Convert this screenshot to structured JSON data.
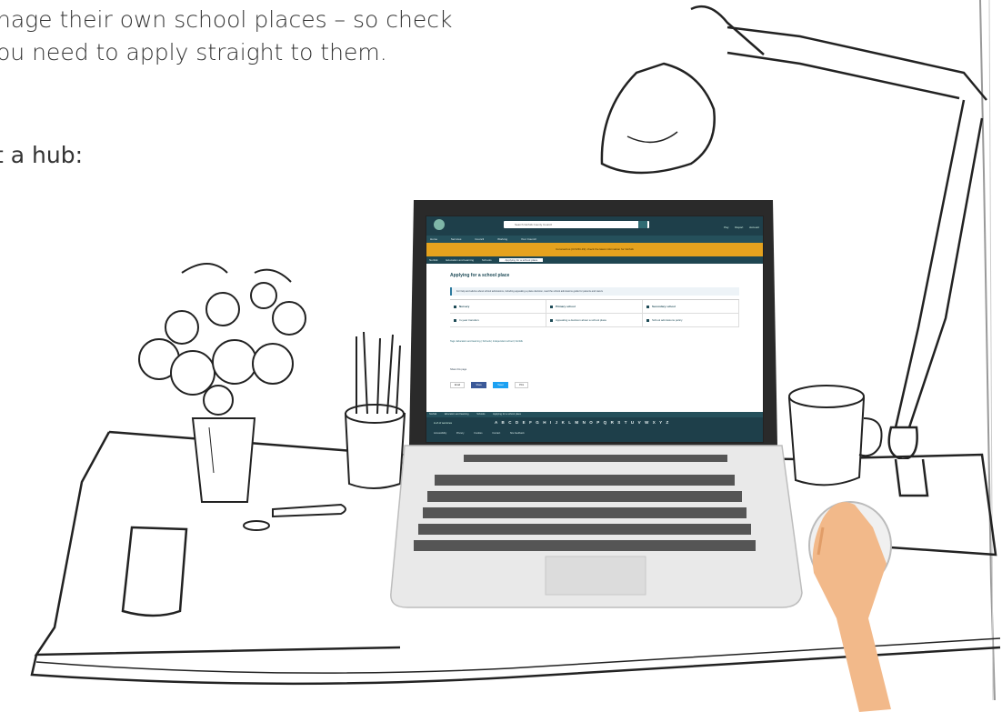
{
  "intro_text": {
    "line1": "nage their own school places – so check",
    "line2": "ou need to apply straight to them."
  },
  "hub_text": "t a hub:",
  "screen": {
    "search_placeholder": "Search Norfolk County Council",
    "utility_links": [
      "Pay",
      "Report",
      "Account"
    ],
    "nav_items": [
      "Home",
      "Services",
      "Council",
      "Working",
      "Your Council"
    ],
    "banner_text": "Coronavirus (COVID-19): check the latest information for Norfolk",
    "breadcrumb": [
      "Norfolk",
      "Education and learning",
      "Schools",
      "Applying for a school place"
    ],
    "title": "Applying for a school place",
    "note": "For help and advice about school admissions, including appealing a place decision, read the school admissions guide for parents and carers",
    "cells": [
      {
        "label": "Nursery",
        "bold": true
      },
      {
        "label": "Primary school",
        "bold": true
      },
      {
        "label": "Secondary school",
        "bold": true
      },
      {
        "label": "In-year transfers",
        "bold": false
      },
      {
        "label": "Appealing a decision about a school place",
        "bold": false
      },
      {
        "label": "School admissions policy",
        "bold": false
      }
    ],
    "more_links": "Tags: Education and learning | Schools | Independent school | Norfolk",
    "share_label": "Share this page",
    "share_buttons": [
      "Email",
      "Share",
      "Tweet",
      "Print"
    ],
    "footer_breadcrumb": [
      "Norfolk",
      "Education and learning",
      "Schools",
      "Applying for a school place"
    ],
    "az_label": "A-Z of services",
    "az_letters": "A B C D E F G H I J K L M N O P Q R S T U V W X Y Z",
    "footer_links": [
      "Accessibility",
      "Privacy",
      "Cookies",
      "Contact",
      "Site feedback"
    ]
  }
}
